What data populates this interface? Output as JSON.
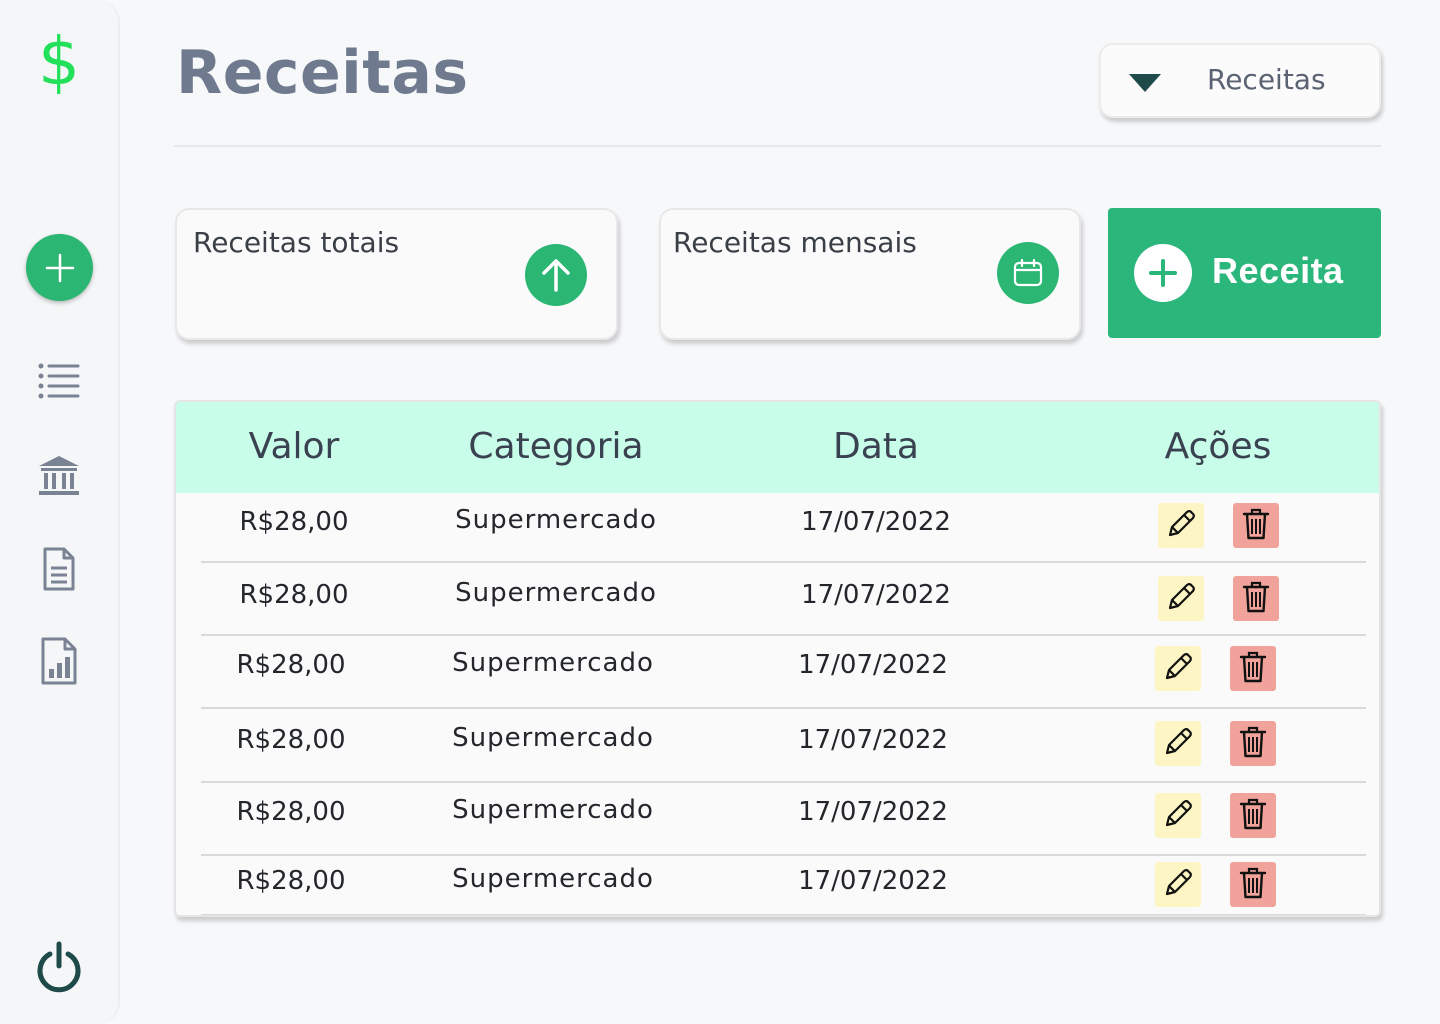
{
  "sidebar": {
    "logo": "$",
    "icons": [
      "plus-icon",
      "list-icon",
      "bank-icon",
      "document-icon",
      "report-icon",
      "power-icon"
    ]
  },
  "header": {
    "title": "Receitas",
    "dropdown_value": "Receitas"
  },
  "cards": {
    "total_label": "Receitas totais",
    "monthly_label": "Receitas mensais"
  },
  "add_button": {
    "label": "Receita"
  },
  "table": {
    "columns": [
      "Valor",
      "Categoria",
      "Data",
      "Ações"
    ],
    "rows": [
      {
        "valor": "R$28,00",
        "categoria": "Supermercado",
        "data": "17/07/2022"
      },
      {
        "valor": "R$28,00",
        "categoria": "Supermercado",
        "data": "17/07/2022"
      },
      {
        "valor": "R$28,00",
        "categoria": "Supermercado",
        "data": "17/07/2022"
      },
      {
        "valor": "R$28,00",
        "categoria": "Supermercado",
        "data": "17/07/2022"
      },
      {
        "valor": "R$28,00",
        "categoria": "Supermercado",
        "data": "17/07/2022"
      },
      {
        "valor": "R$28,00",
        "categoria": "Supermercado",
        "data": "17/07/2022"
      }
    ]
  },
  "colors": {
    "accent": "#2bb673",
    "logo": "#22e05a",
    "table_header": "#c8fde9",
    "edit_bg": "#fdf5c3",
    "delete_bg": "#f1a39b"
  }
}
